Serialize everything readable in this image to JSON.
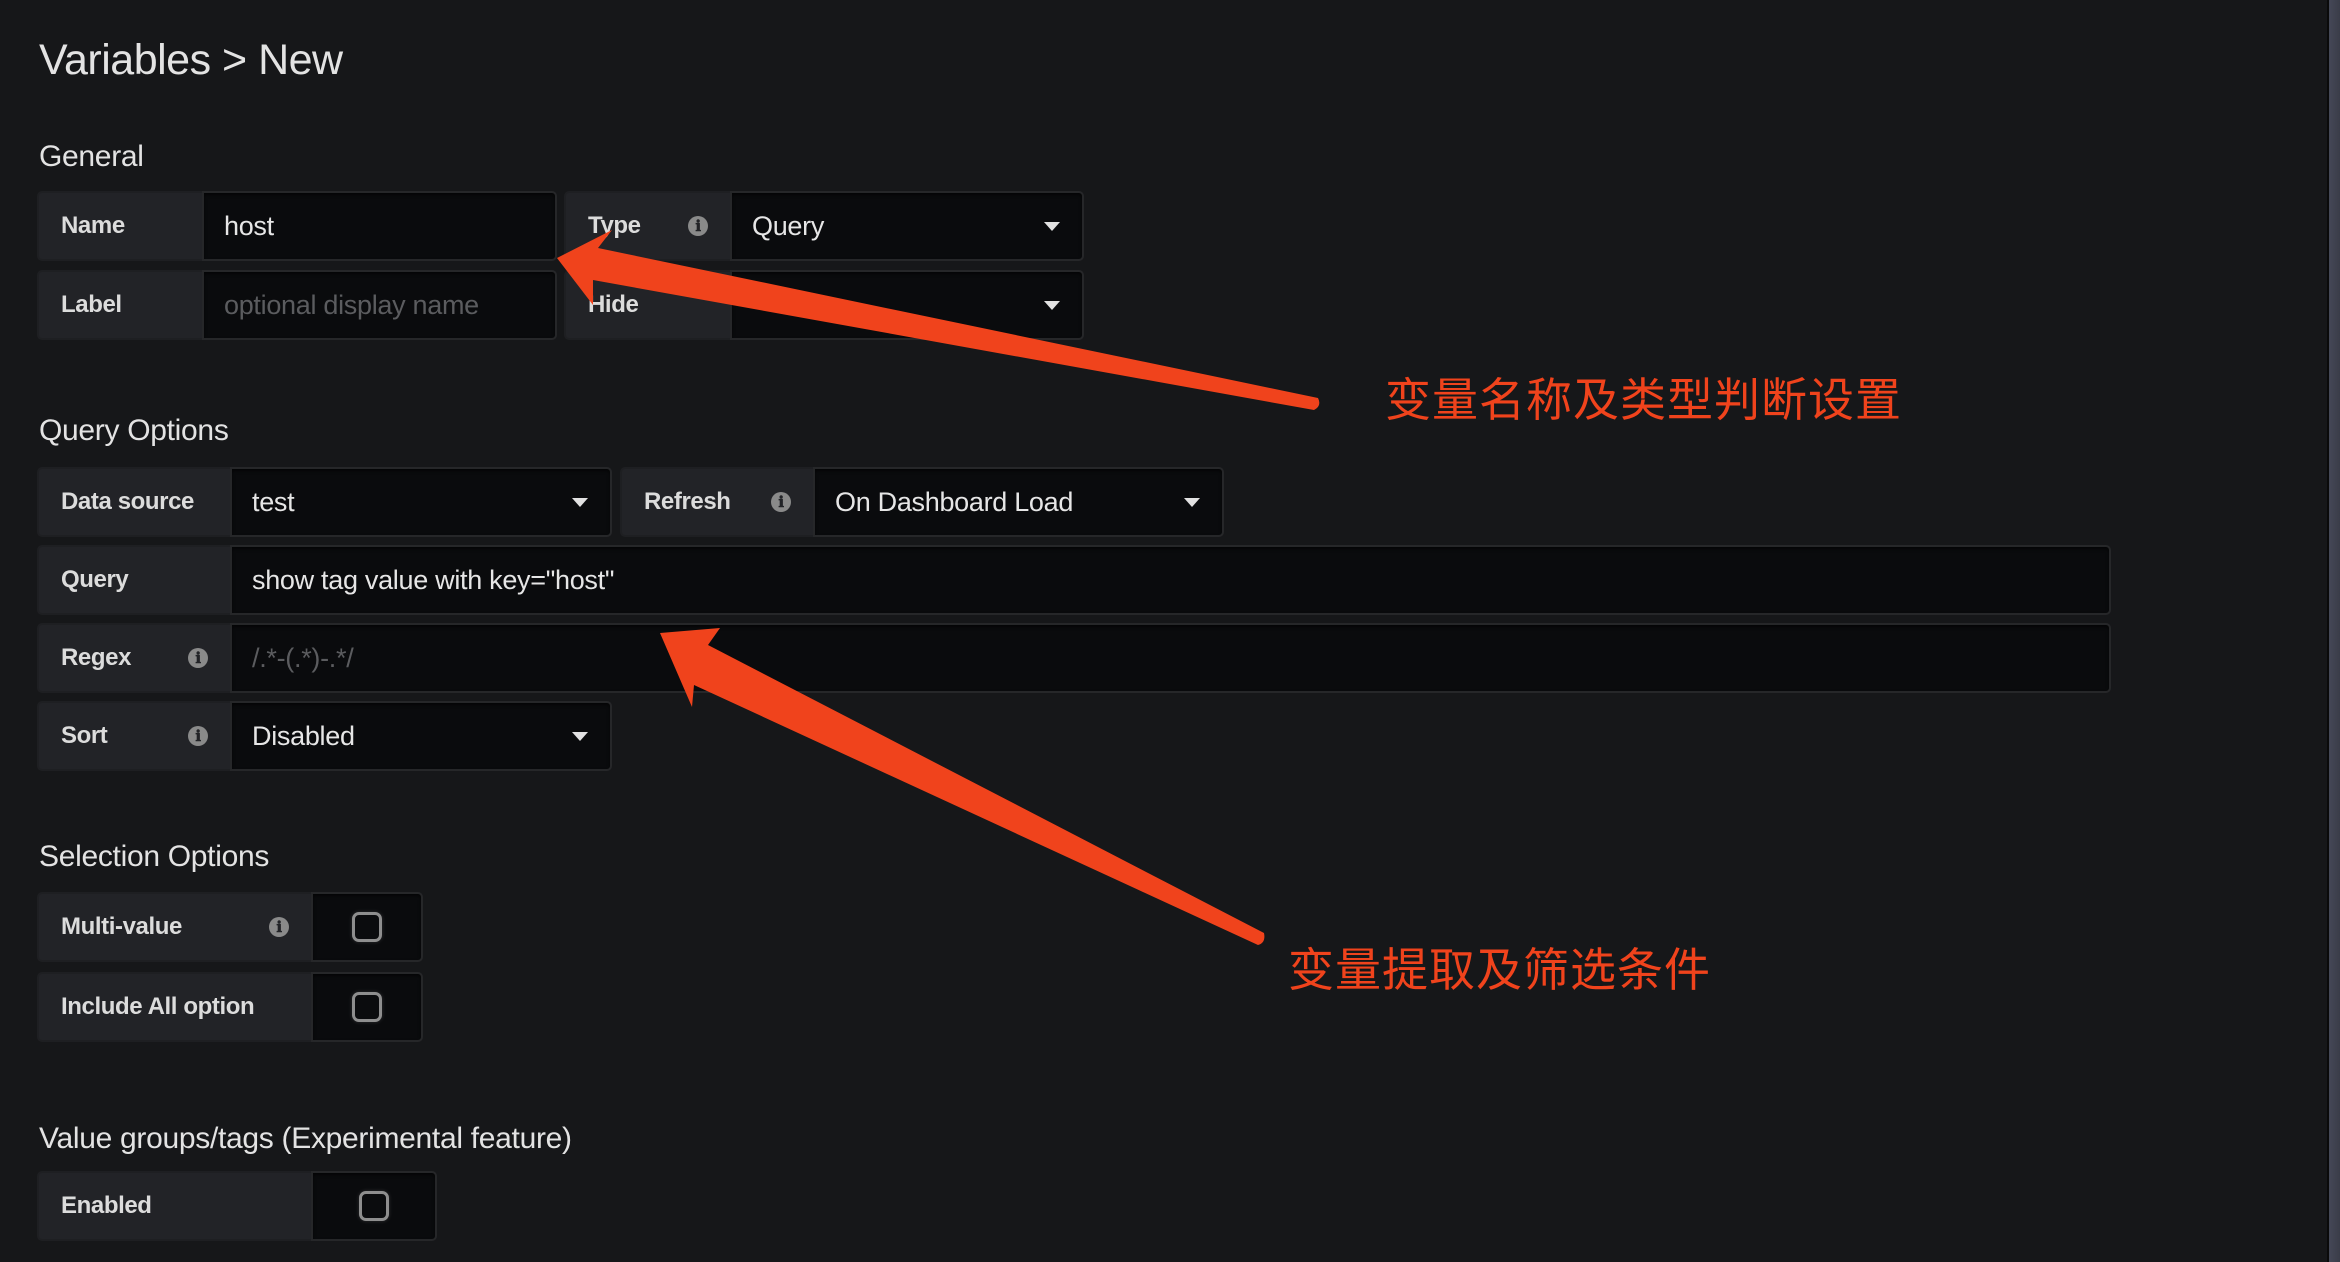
{
  "header": {
    "title": "Variables > New"
  },
  "sections": {
    "general": "General",
    "query_options": "Query Options",
    "selection_options": "Selection Options",
    "value_groups": "Value groups/tags (Experimental feature)"
  },
  "general": {
    "name": {
      "label": "Name",
      "value": "host"
    },
    "label": {
      "label": "Label",
      "value": "",
      "placeholder": "optional display name"
    },
    "type": {
      "label": "Type",
      "value": "Query",
      "info_icon": "info-icon"
    },
    "hide": {
      "label": "Hide",
      "value": ""
    }
  },
  "query_options": {
    "data_source": {
      "label": "Data source",
      "value": "test"
    },
    "refresh": {
      "label": "Refresh",
      "value": "On Dashboard Load",
      "info_icon": "info-icon"
    },
    "query": {
      "label": "Query",
      "value": "show tag value with key=\"host\""
    },
    "regex": {
      "label": "Regex",
      "value": "",
      "placeholder": "/.*-(.*)-.*/",
      "info_icon": "info-icon"
    },
    "sort": {
      "label": "Sort",
      "value": "Disabled",
      "info_icon": "info-icon"
    }
  },
  "selection_options": {
    "multi_value": {
      "label": "Multi-value",
      "checked": false,
      "info_icon": "info-icon"
    },
    "include_all": {
      "label": "Include All option",
      "checked": false
    }
  },
  "value_groups": {
    "enabled": {
      "label": "Enabled",
      "checked": false
    }
  },
  "annotations": {
    "arrow_color": "#f0431c",
    "name_type_note": "变量名称及类型判断设置",
    "query_regex_note": "变量提取及筛选条件"
  },
  "icons": {
    "info": "ℹ",
    "caret": "caret-down-icon",
    "checkbox": "checkbox-unchecked"
  }
}
